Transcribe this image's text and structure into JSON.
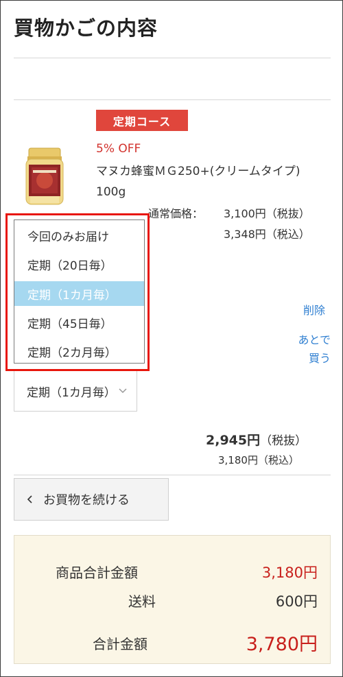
{
  "page": {
    "title": "買物かごの内容"
  },
  "item": {
    "badge": "定期コース",
    "discount": "5% OFF",
    "name": "マヌカ蜂蜜ＭＧ250+(クリームタイプ) 100g",
    "regular_price_label": "通常価格：",
    "price_ex_tax": "3,100円（税抜）",
    "price_in_tax": "3,348円（税込）",
    "delete_label": "削除",
    "later_label_line1": "あとで",
    "later_label_line2": "買う",
    "subtotal_amount": "2,945円",
    "subtotal_ex_label": "（税抜）",
    "subtotal_in_tax": "3,180円（税込）"
  },
  "frequency_select": {
    "selected_display": "定期（1カ月毎）",
    "options": [
      {
        "label": "今回のみお届け",
        "selected": false
      },
      {
        "label": "定期（20日毎）",
        "selected": false
      },
      {
        "label": "定期（1カ月毎）",
        "selected": true
      },
      {
        "label": "定期（45日毎）",
        "selected": false
      },
      {
        "label": "定期（2カ月毎）",
        "selected": false
      }
    ]
  },
  "continue_button": {
    "label": "お買物を続ける"
  },
  "summary": {
    "product_total_label": "商品合計金額",
    "product_total_value": "3,180円",
    "shipping_label": "送料",
    "shipping_value": "600円",
    "grand_total_label": "合計金額",
    "grand_total_value": "3,780円"
  },
  "colors": {
    "badge": "#e0463c",
    "discount": "#d2322d",
    "price_red": "#c8201c",
    "link": "#2f7fd1",
    "selected_option": "#a6d8f0",
    "highlight_box": "#e8160c",
    "summary_bg": "#fbf6e6"
  },
  "icons": {
    "product_image": "honey-jar-image",
    "select_arrow": "chevron-down-icon",
    "back_arrow": "chevron-left-icon"
  }
}
